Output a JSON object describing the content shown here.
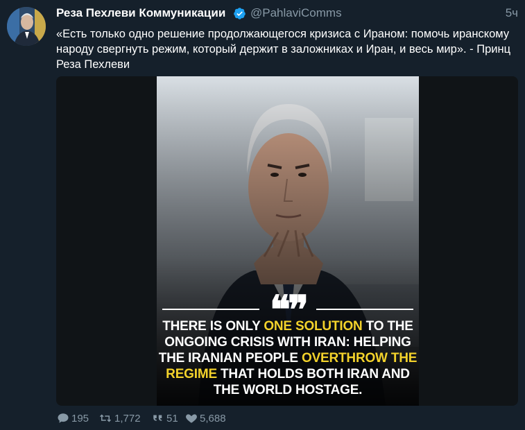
{
  "tweet": {
    "author_name": "Реза Пехлеви Коммуникации",
    "handle": "@PahlaviComms",
    "time": "5ч",
    "text": "«Есть только одно решение продолжающегося кризиса с Ираном: помочь иранскому народу свергнуть режим, который держит в заложниках и Иран, и весь мир». - Принц Реза Пехлеви"
  },
  "media": {
    "quote_mark": "❝❞",
    "caption_parts": [
      {
        "text": "There is only ",
        "highlight": false
      },
      {
        "text": "one solution",
        "highlight": true
      },
      {
        "text": " to the ongoing crisis with Iran: Helping the Iranian people ",
        "highlight": false
      },
      {
        "text": "overthrow the regime",
        "highlight": true
      },
      {
        "text": " that holds both Iran and the world hostage.",
        "highlight": false
      }
    ]
  },
  "actions": {
    "replies": "195",
    "retweets": "1,772",
    "quotes": "51",
    "likes": "5,688"
  },
  "colors": {
    "background": "#15202b",
    "secondary_text": "#8899a6",
    "verified": "#1da1f2",
    "highlight": "#f3d22b"
  },
  "icons": {
    "verified": "verified-badge-icon",
    "reply": "reply-icon",
    "retweet": "retweet-icon",
    "quote": "quote-icon",
    "like": "heart-icon"
  }
}
